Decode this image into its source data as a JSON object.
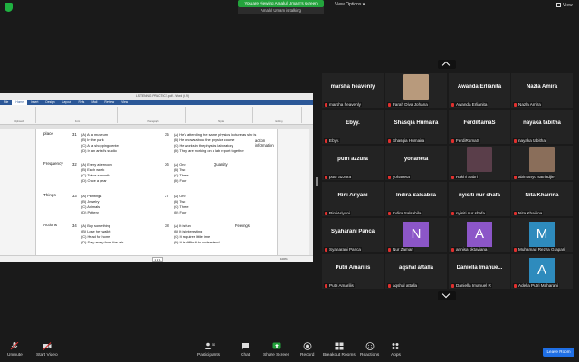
{
  "banner": {
    "sharing": "You are viewing Amalul Umam's screen",
    "sub": "Amalul Umam is talking"
  },
  "topbar": {
    "view_options": "View Options",
    "view": "View"
  },
  "word": {
    "title": "LISTENING PRACTICE.pdf - Word (6.9)",
    "tabs": [
      "File",
      "Home",
      "Insert",
      "Design",
      "Layout",
      "Refs",
      "Mail",
      "Review",
      "View"
    ],
    "ribbon_groups": [
      "Clipboard",
      "Font",
      "Paragraph",
      "Styles",
      "Editing"
    ],
    "page_indicator": "1 of 1",
    "zoom": "100%",
    "doc": {
      "rows": [
        {
          "category": "place",
          "q_left": "31",
          "left": [
            "(A) At a museum",
            "(B) In the park",
            "(C) At a shopping center",
            "(D) In an artist's studio"
          ],
          "q_right": "35",
          "right": [
            "(A) He's attending the same physics lecture as she is",
            "(B) He knows about the physics course",
            "(C) He works in the physics laboratory",
            "(D) They are working on a lab report together"
          ],
          "hint": "action information"
        },
        {
          "category": "Frequency",
          "q_left": "32",
          "left": [
            "(A) Every afternoon",
            "(B) Each week",
            "(C) Twice a month",
            "(D) Once a year"
          ],
          "q_right": "36",
          "right": [
            "(A) One",
            "(B) Two",
            "(C) Three",
            "(D) Four"
          ],
          "hint": "Quantity"
        },
        {
          "category": "Things",
          "q_left": "33",
          "left": [
            "(A) Paintings",
            "(B) Jewelry",
            "(C) Animals",
            "(D) Pottery"
          ],
          "q_right": "37",
          "right": [
            "(A) One",
            "(B) Two",
            "(C) Three",
            "(D) Four"
          ],
          "hint": ""
        },
        {
          "category": "Actions",
          "q_left": "34",
          "left": [
            "(A) Buy something",
            "(B) Lose her wallet",
            "(C) Head for home",
            "(D) Stay away from the fair"
          ],
          "q_right": "38",
          "right": [
            "(A) It is fun",
            "(B) It is interesting",
            "(C) It requires little time",
            "(D) It is difficult to understand"
          ],
          "hint": "Feelings"
        }
      ]
    }
  },
  "participants": [
    {
      "name": "marsha heavenly",
      "label": "marsha heavenly",
      "type": "name"
    },
    {
      "name": "",
      "label": "Farah Diva Johana",
      "type": "photo",
      "color": "#b89a7c"
    },
    {
      "name": "Awanda Erlianita",
      "label": "Awanda Erlianita",
      "type": "name"
    },
    {
      "name": "Nazla Amira",
      "label": "Nazla Amira",
      "type": "name"
    },
    {
      "name": "Ebyy.",
      "label": "Ebyy.",
      "type": "name"
    },
    {
      "name": "Shasqia Humaira",
      "label": "Shasqia Humaira",
      "type": "name"
    },
    {
      "name": "FerdiRamaS",
      "label": "FerdiRamaS",
      "type": "name"
    },
    {
      "name": "nayaka tabitha",
      "label": "nayaka tabitha",
      "type": "name"
    },
    {
      "name": "putri azzura",
      "label": "putri azzura",
      "type": "name"
    },
    {
      "name": "yohaneta",
      "label": "yohaneta",
      "type": "name"
    },
    {
      "name": "",
      "label": "Rakhi Sabri",
      "type": "photo",
      "color": "#5a3e4a"
    },
    {
      "name": "",
      "label": "abimanyu satriadjie",
      "type": "photo",
      "color": "#8a6e5a"
    },
    {
      "name": "Rini Ariyani",
      "label": "Rini Ariyani",
      "type": "name"
    },
    {
      "name": "Indira Salsabila",
      "label": "Indira Salsabila",
      "type": "name"
    },
    {
      "name": "nyisiti nur shafa",
      "label": "nyisiti nur shafa",
      "type": "name"
    },
    {
      "name": "Nita Khairina",
      "label": "Nita Khairina",
      "type": "name"
    },
    {
      "name": "Syaharani Panca",
      "label": "Syaharani Panca",
      "type": "name"
    },
    {
      "name": "N",
      "label": "Nur Zaman",
      "type": "letter",
      "color": "#8c56c8"
    },
    {
      "name": "A",
      "label": "annisa oktaviana",
      "type": "letter",
      "color": "#8c56c8"
    },
    {
      "name": "M",
      "label": "Muhamad Rezza Grapari",
      "type": "letter",
      "color": "#2e8bbd"
    },
    {
      "name": "Putri Amarilis",
      "label": "Putri Amarilis",
      "type": "name"
    },
    {
      "name": "aqshal attalla",
      "label": "aqshal attalla",
      "type": "name"
    },
    {
      "name": "Daniella Imanue...",
      "label": "Daniella Imanuel R",
      "type": "name"
    },
    {
      "name": "A",
      "label": "Adelia Putri Maharani",
      "type": "letter",
      "color": "#2e8bbd"
    }
  ],
  "toolbar": {
    "unmute": "Unmute",
    "start_video": "Start Video",
    "participants": "Participants",
    "participants_count": "56",
    "chat": "Chat",
    "share_screen": "Share Screen",
    "record": "Record",
    "breakout": "Breakout Rooms",
    "reactions": "Reactions",
    "apps": "Apps",
    "leave": "Leave Room"
  },
  "colors": {
    "accent_green": "#23a33c",
    "leave_blue": "#1f6fe5",
    "mute_red": "#e0302e"
  }
}
